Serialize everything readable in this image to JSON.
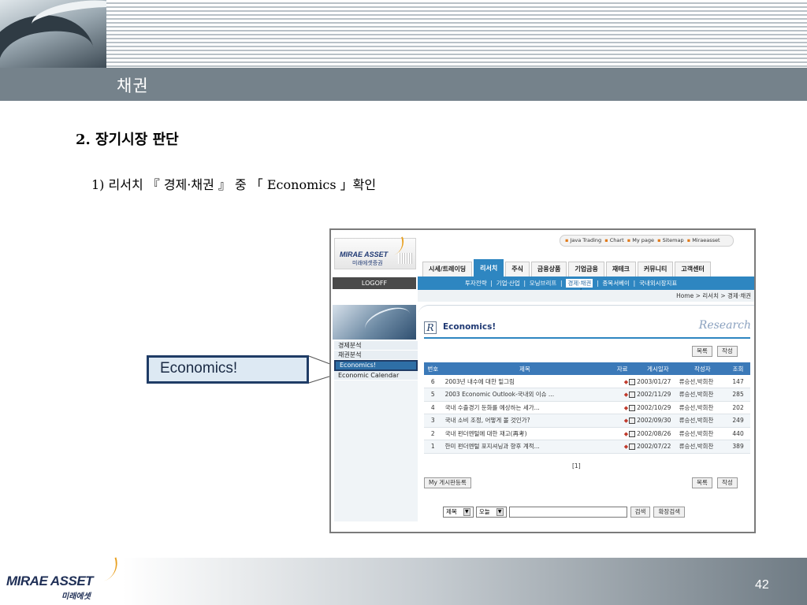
{
  "slide": {
    "title": "채권",
    "heading": "2. 장기시장 판단",
    "subheading": "1) 리서치 『 경제·채권 』 중 「 Economics 」확인",
    "callout_label": "Economics!",
    "page_number": "42"
  },
  "footer": {
    "logo_main": "MIRAE ASSET",
    "logo_sub": "미래에셋"
  },
  "site": {
    "logo_main": "MIRAE ASSET",
    "logo_sub": "미래에셋증권",
    "logoff": "LOGOFF",
    "util_links": [
      "Java Trading",
      "Chart",
      "My page",
      "Sitemap",
      "Miraeasset"
    ],
    "tabs": [
      "시세/트레이딩",
      "리서치",
      "주식",
      "금융상품",
      "기업금융",
      "재테크",
      "커뮤니티",
      "고객센터"
    ],
    "active_tab": "리서치",
    "subnav": [
      "투자전략",
      "기업·산업",
      "모닝브리프",
      "경제·채권",
      "종목서베이",
      "국내외시장지표"
    ],
    "subnav_selected": "경제·채권",
    "breadcrumb": "Home > 리서치 > 경제·채권",
    "left_menu": [
      "경제분석",
      "채권분석",
      "Economics!",
      "Economic Calendar"
    ],
    "left_menu_selected": "Economics!"
  },
  "board": {
    "title": "Economics!",
    "brand": "Research",
    "btn_list": "목록",
    "btn_write": "작성",
    "columns": [
      "번호",
      "제목",
      "자료",
      "게시일자",
      "작성자",
      "조회"
    ],
    "rows": [
      {
        "no": "6",
        "title": "2003년 내수에 대한 밑그림",
        "date": "2003/01/27",
        "author": "류승선,박희찬",
        "views": "147",
        "views_color": "blue"
      },
      {
        "no": "5",
        "title": "2003 Economic Outlook-국내외 이슈 ...",
        "date": "2002/11/29",
        "author": "류승선,박희찬",
        "views": "285",
        "views_color": "orange"
      },
      {
        "no": "4",
        "title": "국내 수출경기 둔화를 예상하는 세가...",
        "date": "2002/10/29",
        "author": "류승선,박희찬",
        "views": "202",
        "views_color": "orange"
      },
      {
        "no": "3",
        "title": "국내 소비 조정, 어떻게 볼 것인가?",
        "date": "2002/09/30",
        "author": "류승선,박희찬",
        "views": "249",
        "views_color": "orange"
      },
      {
        "no": "2",
        "title": "국내 펀더멘털에 대한 재고(再考)",
        "date": "2002/08/26",
        "author": "류승선,박희찬",
        "views": "440",
        "views_color": "orange"
      },
      {
        "no": "1",
        "title": "한미 펀더멘털 포지셔닝과 향후 계적...",
        "date": "2002/07/22",
        "author": "류승선,박희찬",
        "views": "389",
        "views_color": "orange"
      }
    ],
    "pager": "[1]",
    "btn_my_board": "My 게시판등록",
    "search": {
      "field_select": "제목",
      "period_select": "오늘",
      "query": "",
      "btn_search": "검색",
      "btn_advanced": "확장검색"
    }
  },
  "colors": {
    "header_bar": "#75828b",
    "site_blue": "#2e86c1",
    "table_header": "#3b79b8",
    "callout_border": "#1f3c66"
  }
}
